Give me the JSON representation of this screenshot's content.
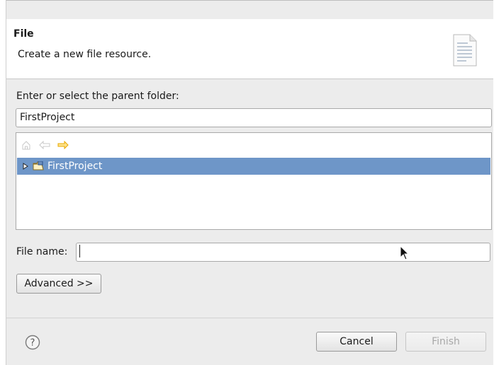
{
  "banner": {
    "title": "File",
    "subtitle": "Create a new file resource.",
    "icon": "new-file-document-icon"
  },
  "parent_folder": {
    "label": "Enter or select the parent folder:",
    "value": "FirstProject"
  },
  "tree": {
    "toolbar": [
      {
        "name": "home-icon",
        "enabled": false
      },
      {
        "name": "back-arrow-icon",
        "enabled": false
      },
      {
        "name": "forward-arrow-icon",
        "enabled": true
      }
    ],
    "items": [
      {
        "label": "FirstProject",
        "selected": true,
        "expanded": false,
        "icon": "project-folder-icon"
      }
    ]
  },
  "file_name": {
    "label": "File name:",
    "value": ""
  },
  "advanced_button": "Advanced >>",
  "footer": {
    "help_icon": "help-icon",
    "cancel_label": "Cancel",
    "finish_label": "Finish",
    "finish_enabled": false
  },
  "colors": {
    "selection": "#6e96c8",
    "dialog_bg": "#ececec",
    "forward_arrow": "#e8a800"
  }
}
